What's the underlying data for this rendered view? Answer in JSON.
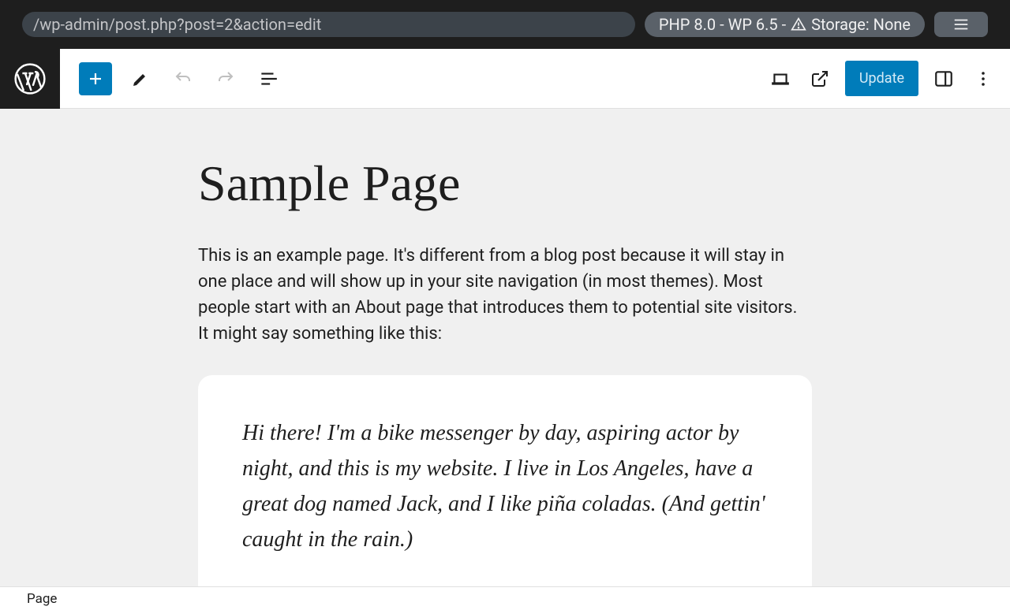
{
  "topbar": {
    "url": "/wp-admin/post.php?post=2&action=edit",
    "status_prefix": "PHP 8.0 - WP 6.5 - ",
    "status_suffix": " Storage: None"
  },
  "toolbar": {
    "update_label": "Update"
  },
  "page": {
    "title": "Sample Page",
    "intro": "This is an example page. It's different from a blog post because it will stay in one place and will show up in your site navigation (in most themes). Most people start with an About page that introduces them to potential site visitors. It might say something like this:",
    "quote": "Hi there! I'm a bike messenger by day, aspiring actor by night, and this is my website. I live in Los Angeles, have a great dog named Jack, and I like piña coladas. (And gettin' caught in the rain.)"
  },
  "footer": {
    "breadcrumb": "Page"
  }
}
